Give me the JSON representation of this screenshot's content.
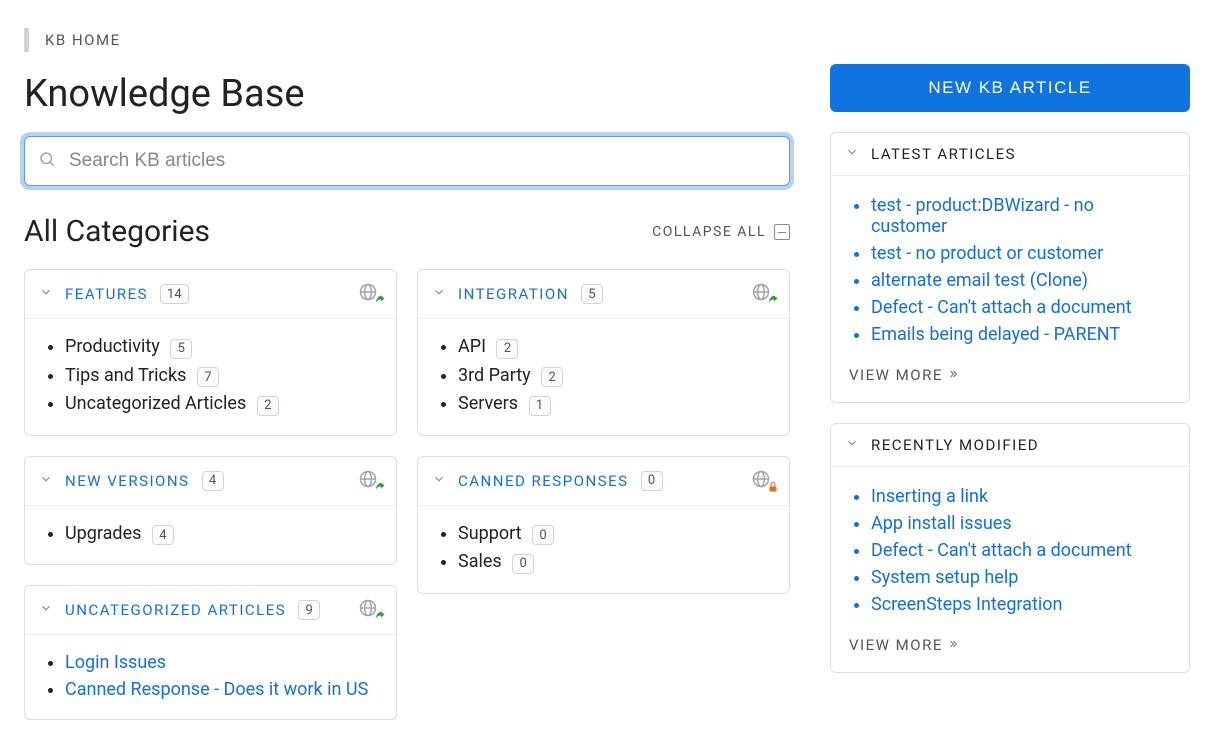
{
  "breadcrumb": "KB HOME",
  "page_title": "Knowledge Base",
  "search": {
    "placeholder": "Search KB articles"
  },
  "all_categories_heading": "All Categories",
  "collapse_all_label": "COLLAPSE ALL",
  "new_article_button": "NEW KB ARTICLE",
  "view_more_label": "VIEW MORE",
  "columns": [
    {
      "cards": [
        {
          "title": "FEATURES",
          "title_link": true,
          "count": "14",
          "overlay": "share",
          "items": [
            {
              "label": "Productivity",
              "count": "5",
              "link": false
            },
            {
              "label": "Tips and Tricks",
              "count": "7",
              "link": false
            },
            {
              "label": "Uncategorized Articles",
              "count": "2",
              "link": false
            }
          ]
        },
        {
          "title": "NEW VERSIONS",
          "title_link": true,
          "count": "4",
          "overlay": "share",
          "items": [
            {
              "label": "Upgrades",
              "count": "4",
              "link": false
            }
          ]
        },
        {
          "title": "UNCATEGORIZED ARTICLES",
          "title_link": true,
          "count": "9",
          "overlay": "share",
          "items": [
            {
              "label": "Login Issues",
              "link": true
            },
            {
              "label": "Canned Response - Does it work in US",
              "link": true
            }
          ]
        }
      ]
    },
    {
      "cards": [
        {
          "title": "INTEGRATION",
          "title_link": true,
          "count": "5",
          "overlay": "share",
          "items": [
            {
              "label": "API",
              "count": "2",
              "link": false
            },
            {
              "label": "3rd Party",
              "count": "2",
              "link": false
            },
            {
              "label": "Servers",
              "count": "1",
              "link": false
            }
          ]
        },
        {
          "title": "CANNED RESPONSES",
          "title_link": true,
          "count": "0",
          "overlay": "lock",
          "items": [
            {
              "label": "Support",
              "count": "0",
              "link": false
            },
            {
              "label": "Sales",
              "count": "0",
              "link": false
            }
          ]
        }
      ]
    }
  ],
  "sidebar": {
    "latest": {
      "title": "LATEST ARTICLES",
      "items": [
        "test - product:DBWizard - no customer",
        "test - no product or customer",
        "alternate email test (Clone)",
        "Defect - Can't attach a document",
        "Emails being delayed - PARENT"
      ]
    },
    "recent": {
      "title": "RECENTLY MODIFIED",
      "items": [
        "Inserting a link",
        "App install issues",
        "Defect - Can't attach a document",
        "System setup help",
        "ScreenSteps Integration"
      ]
    }
  }
}
